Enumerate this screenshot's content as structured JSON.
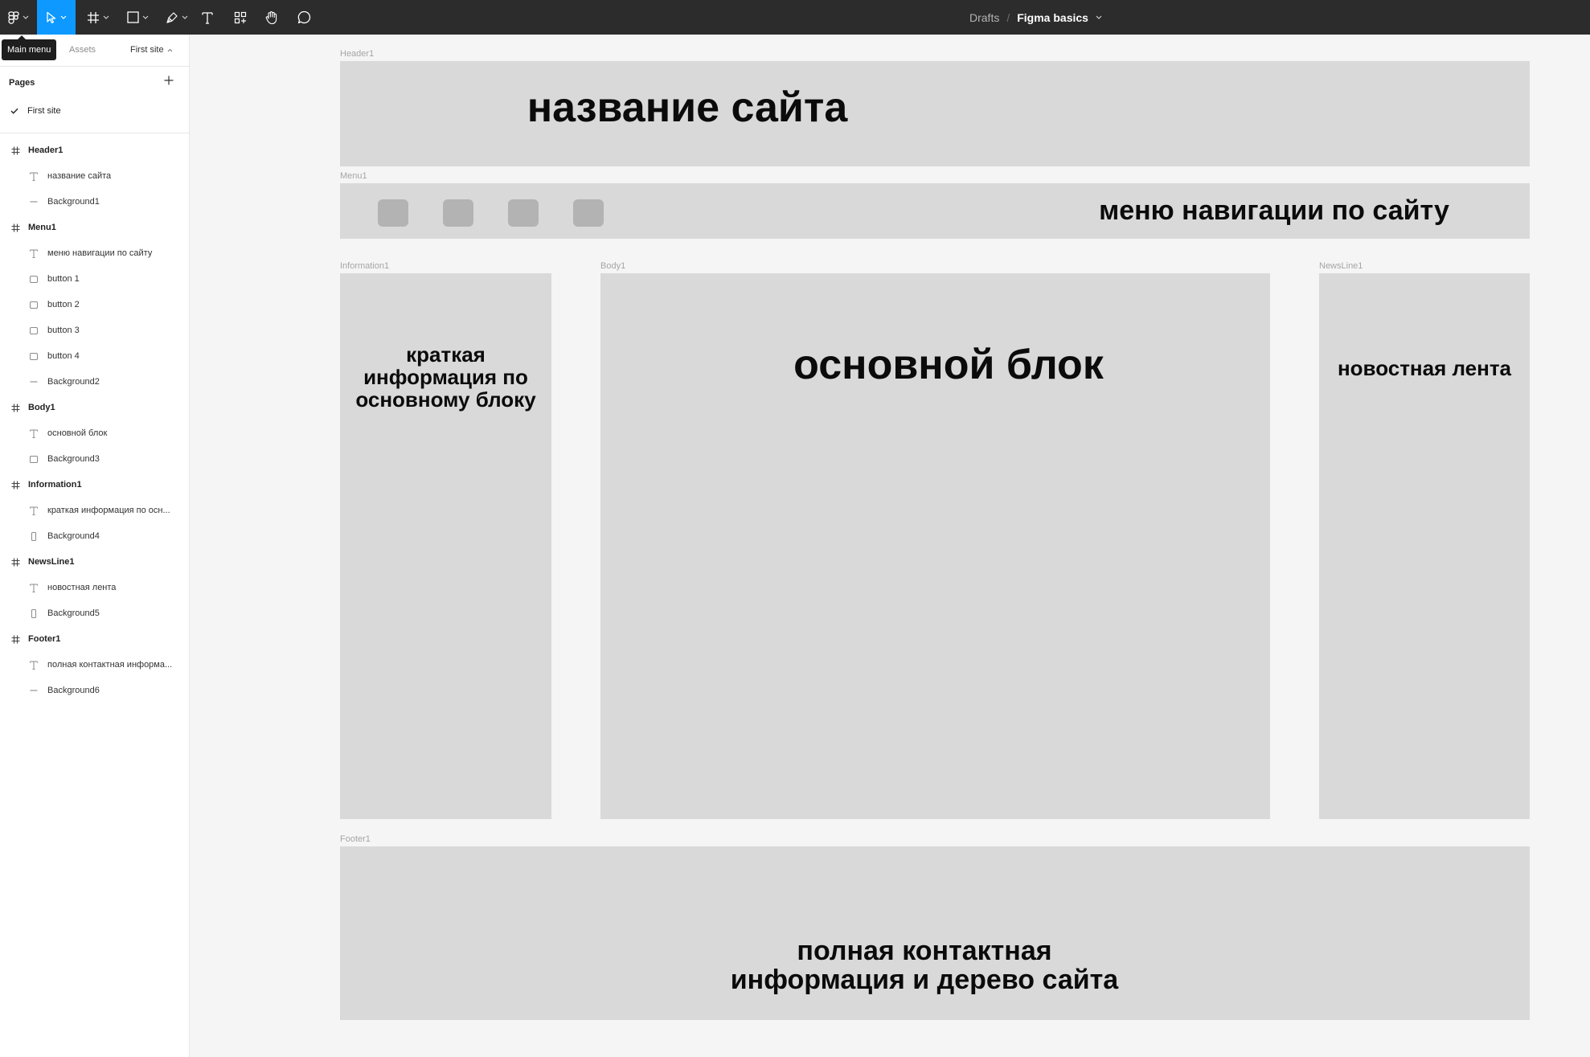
{
  "toolbar": {
    "tools": [
      {
        "name": "main-menu",
        "icon": "figma-logo-icon"
      },
      {
        "name": "move",
        "icon": "cursor-arrow-icon",
        "active": true
      },
      {
        "name": "frame",
        "icon": "frame-hash-icon"
      },
      {
        "name": "shape",
        "icon": "rectangle-icon"
      },
      {
        "name": "pen",
        "icon": "pen-icon"
      },
      {
        "name": "text",
        "icon": "text-t-icon"
      },
      {
        "name": "resources",
        "icon": "components-icon"
      },
      {
        "name": "hand",
        "icon": "hand-icon"
      },
      {
        "name": "comment",
        "icon": "comment-bubble-icon"
      }
    ],
    "breadcrumb": {
      "folder": "Drafts",
      "separator": "/",
      "file": "Figma basics"
    },
    "active_color": "#0d99ff",
    "bg_color": "#2c2c2c"
  },
  "sidebar": {
    "tooltip": "Main menu",
    "tab_assets": "Assets",
    "page_selector": "First site",
    "pages_title": "Pages",
    "pages": [
      {
        "name": "First site",
        "selected": true
      }
    ],
    "layers": [
      {
        "name": "Header1",
        "kind": "frame"
      },
      {
        "name": "название сайта",
        "kind": "text"
      },
      {
        "name": "Background1",
        "kind": "line"
      },
      {
        "name": "Menu1",
        "kind": "frame"
      },
      {
        "name": "меню навигации по сайту",
        "kind": "text"
      },
      {
        "name": "button 1",
        "kind": "rect"
      },
      {
        "name": "button 2",
        "kind": "rect"
      },
      {
        "name": "button 3",
        "kind": "rect"
      },
      {
        "name": "button 4",
        "kind": "rect"
      },
      {
        "name": "Background2",
        "kind": "line"
      },
      {
        "name": "Body1",
        "kind": "frame"
      },
      {
        "name": "основной блок",
        "kind": "text"
      },
      {
        "name": "Background3",
        "kind": "rect"
      },
      {
        "name": "Information1",
        "kind": "frame"
      },
      {
        "name": "краткая информация по осн...",
        "kind": "text"
      },
      {
        "name": "Background4",
        "kind": "tall"
      },
      {
        "name": "NewsLine1",
        "kind": "frame"
      },
      {
        "name": "новостная лента",
        "kind": "text"
      },
      {
        "name": "Background5",
        "kind": "tall"
      },
      {
        "name": "Footer1",
        "kind": "frame"
      },
      {
        "name": "полная контактная информа...",
        "kind": "text"
      },
      {
        "name": "Background6",
        "kind": "line"
      }
    ]
  },
  "canvas": {
    "header": {
      "label": "Header1",
      "text": "название сайта"
    },
    "menu": {
      "label": "Menu1",
      "text": "меню навигации по сайту",
      "button_count": 4
    },
    "information": {
      "label": "Information1",
      "text": "краткая информация по основному блоку"
    },
    "body": {
      "label": "Body1",
      "text": "основной блок"
    },
    "newsline": {
      "label": "NewsLine1",
      "text": "новостная лента"
    },
    "footer": {
      "label": "Footer1",
      "text_line1": "полная контактная",
      "text_line2": "информация и дерево сайта"
    },
    "frame_color": "#d9d9d9",
    "button_color": "#b3b3b3",
    "canvas_color": "#f5f5f5"
  }
}
